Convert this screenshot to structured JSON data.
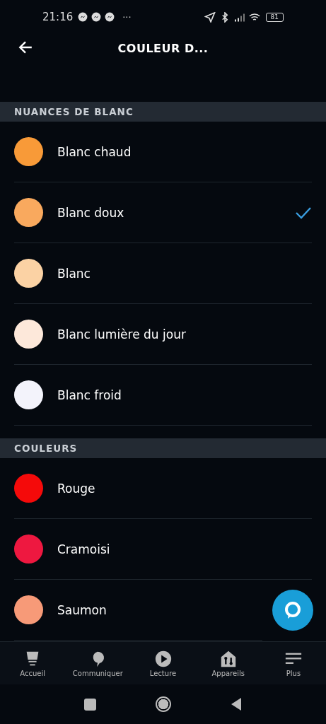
{
  "status_bar": {
    "time": "21:16",
    "more": "···",
    "battery": "81"
  },
  "header": {
    "title": "COULEUR D..."
  },
  "sections": [
    {
      "title": "NUANCES DE BLANC",
      "items": [
        {
          "label": "Blanc chaud",
          "color": "#f89a38",
          "selected": false
        },
        {
          "label": "Blanc doux",
          "color": "#f9a95e",
          "selected": true
        },
        {
          "label": "Blanc",
          "color": "#fbd2a4",
          "selected": false
        },
        {
          "label": "Blanc lumière du jour",
          "color": "#fde8da",
          "selected": false
        },
        {
          "label": "Blanc froid",
          "color": "#f3f3fb",
          "selected": false
        }
      ]
    },
    {
      "title": "COULEURS",
      "items": [
        {
          "label": "Rouge",
          "color": "#f50a0a",
          "selected": false
        },
        {
          "label": "Cramoisi",
          "color": "#ee1840",
          "selected": false
        },
        {
          "label": "Saumon",
          "color": "#f79a78",
          "selected": false
        }
      ]
    }
  ],
  "nav": [
    {
      "label": "Accueil",
      "kind": "home"
    },
    {
      "label": "Communiquer",
      "kind": "chat"
    },
    {
      "label": "Lecture",
      "kind": "play"
    },
    {
      "label": "Appareils",
      "kind": "devices"
    },
    {
      "label": "Plus",
      "kind": "more"
    }
  ]
}
